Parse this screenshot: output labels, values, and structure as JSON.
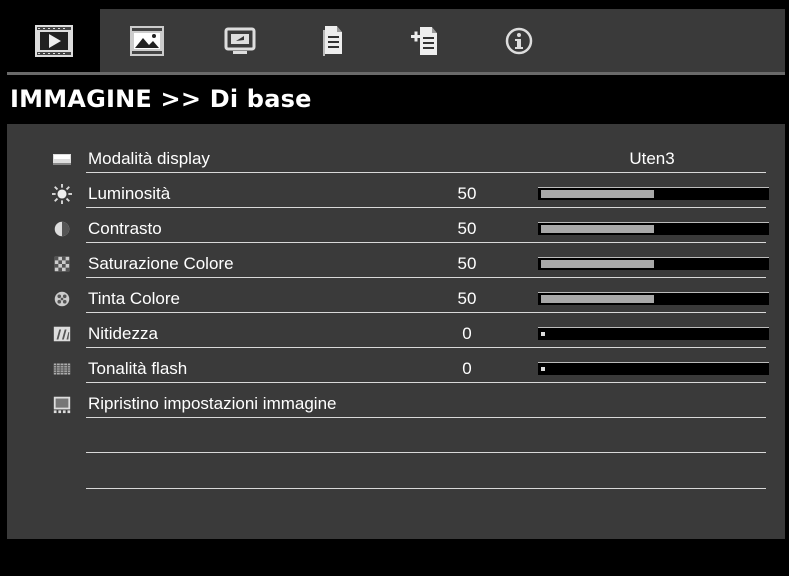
{
  "tabs": [
    {
      "name": "image-tab",
      "icon": "play-screen-icon",
      "active": true
    },
    {
      "name": "advanced-image-tab",
      "icon": "picture-icon",
      "active": false
    },
    {
      "name": "display-tab",
      "icon": "monitor-icon",
      "active": false
    },
    {
      "name": "settings-tab",
      "icon": "document-icon",
      "active": false
    },
    {
      "name": "options-tab",
      "icon": "document-plus-icon",
      "active": false
    },
    {
      "name": "info-tab",
      "icon": "info-icon",
      "active": false
    }
  ],
  "title": "IMMAGINE >> Di base",
  "menu": {
    "items": [
      {
        "label": "Modalità display",
        "icon": "display-mode-icon",
        "value": "Uten3"
      },
      {
        "label": "Luminosità",
        "icon": "brightness-icon",
        "value": "50",
        "level": 0.5
      },
      {
        "label": "Contrasto",
        "icon": "contrast-icon",
        "value": "50",
        "level": 0.5
      },
      {
        "label": "Saturazione Colore",
        "icon": "saturation-icon",
        "value": "50",
        "level": 0.5
      },
      {
        "label": "Tinta Colore",
        "icon": "tint-icon",
        "value": "50",
        "level": 0.5
      },
      {
        "label": "Nitidezza",
        "icon": "sharpness-icon",
        "value": "0",
        "level": 0
      },
      {
        "label": "Tonalità flash",
        "icon": "flesh-tone-icon",
        "value": "0",
        "level": 0
      },
      {
        "label": "Ripristino impostazioni immagine",
        "icon": "reset-image-icon"
      }
    ]
  },
  "colors": {
    "background": "#3a3a3a",
    "band": "#000000",
    "slider_fill": "#a8a8a8",
    "text": "#ffffff"
  }
}
